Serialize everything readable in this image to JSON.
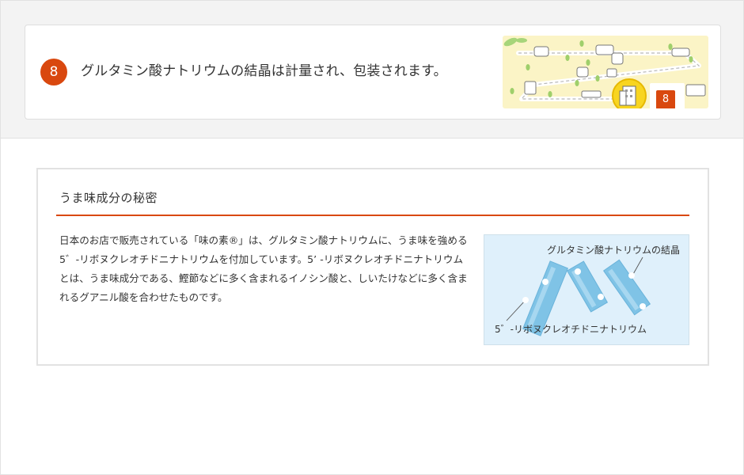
{
  "colors": {
    "accent": "#d9480f",
    "band": "#f3f3f3",
    "border": "#e2e2e2",
    "map_bg": "#fbf4c6",
    "figure_bg": "#dff0fb",
    "crystal": "#7fc3e6"
  },
  "step": {
    "number": "8",
    "text": "グルタミン酸ナトリウムの結晶は計量され、包装されます。",
    "map": {
      "icon": "factory-route-map",
      "highlight_icon": "packaging-building-icon",
      "number": "8"
    }
  },
  "secret": {
    "title": "うま味成分の秘密",
    "body": "日本のお店で販売されている「味の素®」は、グルタミン酸ナトリウムに、うま味を強める5゛-リボヌクレオチドニナトリウムを付加しています。5’ -リボヌクレオチドニナトリウムとは、うま味成分である、鰹節などに多く含まれるイノシン酸と、しいたけなどに多く含まれるグアニル酸を合わせたものです。",
    "figure": {
      "label_glutamate": "グルタミン酸ナトリウムの結晶",
      "label_ribonucleotide": "5゛-リボヌクレオチドニナトリウム"
    }
  }
}
